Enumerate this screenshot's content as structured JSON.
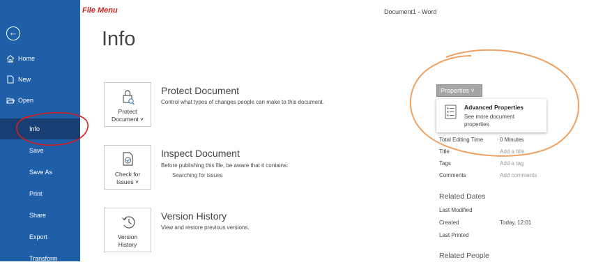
{
  "title_bar": {
    "annotation_label": "File Menu",
    "document_title": "Document1  -  Word"
  },
  "sidebar": {
    "back_icon": "back-arrow-icon",
    "items": [
      {
        "label": "Home",
        "icon": "home-icon"
      },
      {
        "label": "New",
        "icon": "new-document-icon"
      },
      {
        "label": "Open",
        "icon": "folder-open-icon"
      },
      {
        "label": "Info",
        "active": true
      },
      {
        "label": "Save"
      },
      {
        "label": "Save As"
      },
      {
        "label": "Print"
      },
      {
        "label": "Share"
      },
      {
        "label": "Export"
      },
      {
        "label": "Transform"
      }
    ],
    "colors": {
      "background": "#1e5fa8",
      "active": "#173f73"
    }
  },
  "main": {
    "page_title": "Info",
    "protect": {
      "button_line1": "Protect",
      "button_line2": "Document ˅",
      "icon": "lock-document-icon",
      "heading": "Protect Document",
      "description": "Control what types of changes people can make to this document."
    },
    "inspect": {
      "button_line1": "Check for",
      "button_line2": "Issues ˅",
      "icon": "check-document-icon",
      "heading": "Inspect Document",
      "description": "Before publishing this file, be aware that it contains:",
      "status": "Searching for issues"
    },
    "version": {
      "button_line1": "Version",
      "button_line2": "History",
      "icon": "history-clock-icon",
      "heading": "Version History",
      "description": "View and restore previous versions."
    }
  },
  "properties": {
    "button_label": "Properties ˅",
    "advanced": {
      "title": "Advanced Properties",
      "desc_line1": "See more document",
      "desc_line2": "properties",
      "icon": "properties-list-icon"
    },
    "rows": [
      {
        "label": "Total Editing Time",
        "value": "0 Minutes"
      },
      {
        "label": "Title",
        "value": "Add a title"
      },
      {
        "label": "Tags",
        "value": "Add a tag"
      },
      {
        "label": "Comments",
        "value": "Add comments"
      }
    ],
    "related_dates": {
      "heading": "Related Dates",
      "rows": [
        {
          "label": "Last Modified",
          "value": ""
        },
        {
          "label": "Created",
          "value": "Today, 12:01"
        },
        {
          "label": "Last Printed",
          "value": ""
        }
      ]
    },
    "related_people_heading": "Related People"
  },
  "annotations": {
    "circle_color_red": "#d42020",
    "circle_color_orange": "#f0a060"
  }
}
